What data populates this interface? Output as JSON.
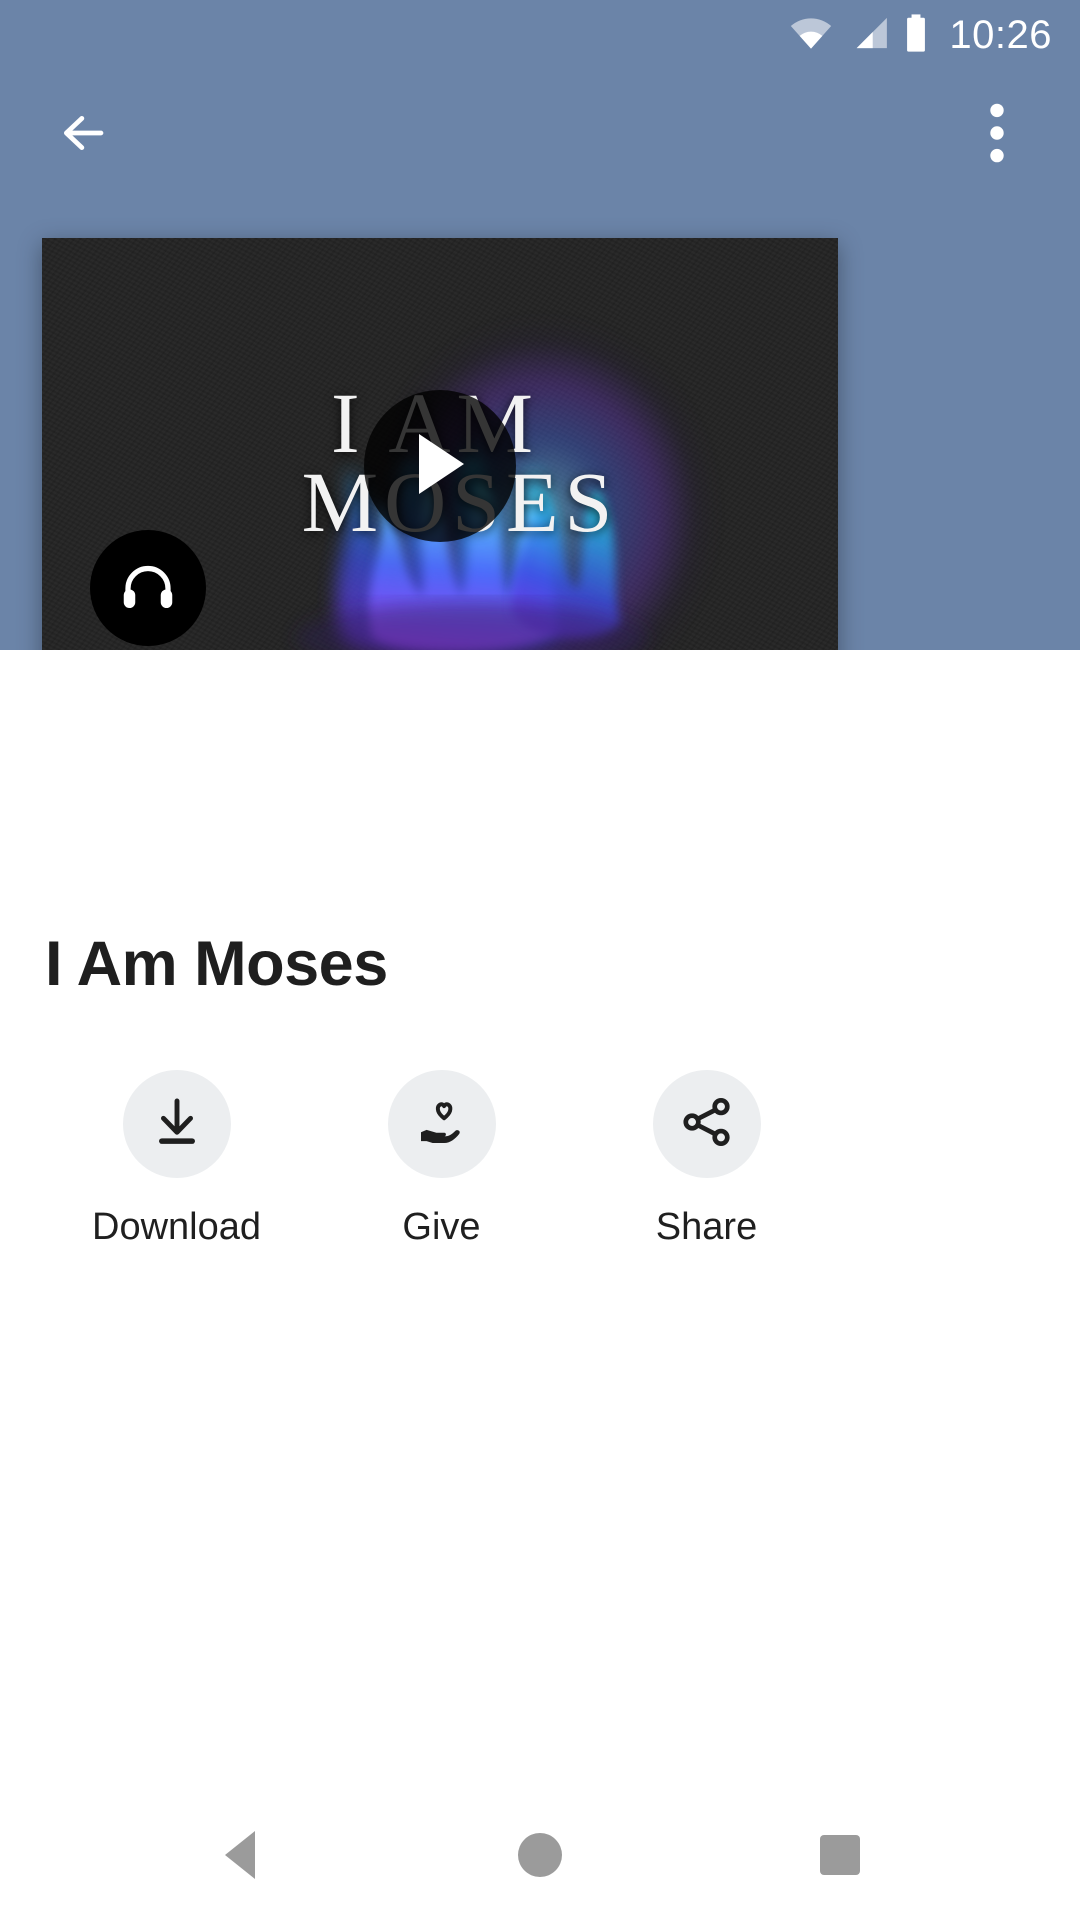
{
  "status_bar": {
    "time": "10:26",
    "icons": [
      "wifi-icon",
      "cellular-signal-icon",
      "battery-icon"
    ]
  },
  "app_bar": {
    "back_label": "back-arrow-icon",
    "overflow_label": "more-options-icon",
    "background_color": "#6b84a8"
  },
  "video_card": {
    "artwork_title_line1": "I AM",
    "artwork_title_line2": "MOSES",
    "play_button_label": "play-icon",
    "audio_badge_label": "headphones-icon",
    "background_color": "#232323"
  },
  "content": {
    "title": "I Am Moses"
  },
  "actions": [
    {
      "label": "Download",
      "icon": "download-icon"
    },
    {
      "label": "Give",
      "icon": "hand-heart-icon"
    },
    {
      "label": "Share",
      "icon": "share-icon"
    }
  ],
  "nav_bar": {
    "back": "nav-back-icon",
    "home": "nav-home-icon",
    "recents": "nav-recents-icon",
    "color": "#9b9b9b"
  }
}
